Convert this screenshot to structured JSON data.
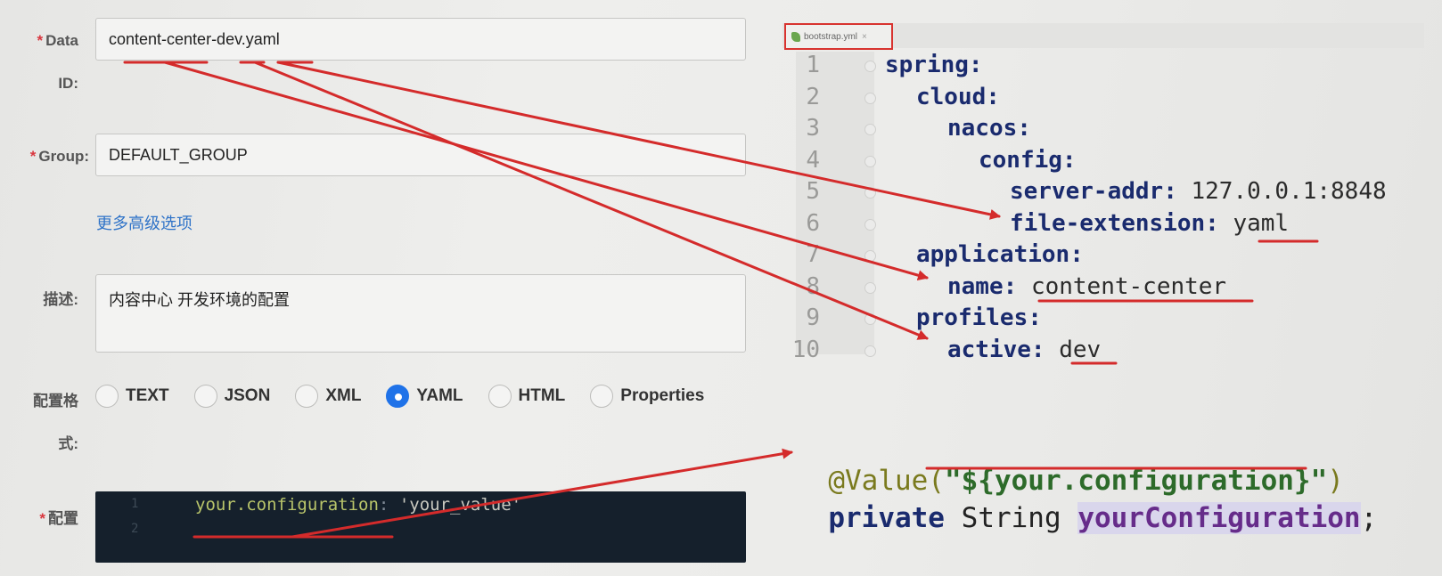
{
  "form": {
    "data_id": {
      "label_line1": "Data",
      "label_line2": "ID:",
      "value": "content-center-dev.yaml"
    },
    "group": {
      "label": "Group:",
      "value": "DEFAULT_GROUP"
    },
    "advanced_link": "更多高级选项",
    "description": {
      "label": "描述:",
      "value": "内容中心 开发环境的配置"
    },
    "format": {
      "label_line1": "配置格",
      "label_line2": "式:",
      "options": [
        "TEXT",
        "JSON",
        "XML",
        "YAML",
        "HTML",
        "Properties"
      ],
      "selected": "YAML"
    },
    "config": {
      "label": "配置",
      "line_numbers": [
        "1",
        "2"
      ],
      "key": "your.configuration",
      "colon": ":",
      "value": "'your_value'"
    },
    "required_mark": "*"
  },
  "editor": {
    "tab_label": "bootstrap.yml",
    "tab_close": "×",
    "lines": [
      {
        "num": "1",
        "key": "spring",
        "sep": ":",
        "value": ""
      },
      {
        "num": "2",
        "key": "cloud",
        "sep": ":",
        "value": ""
      },
      {
        "num": "3",
        "key": "nacos",
        "sep": ":",
        "value": ""
      },
      {
        "num": "4",
        "key": "config",
        "sep": ":",
        "value": ""
      },
      {
        "num": "5",
        "key": "server-addr",
        "sep": ": ",
        "value": "127.0.0.1:8848"
      },
      {
        "num": "6",
        "key": "file-extension",
        "sep": ": ",
        "value": "yaml"
      },
      {
        "num": "7",
        "key": "application",
        "sep": ":",
        "value": ""
      },
      {
        "num": "8",
        "key": "name",
        "sep": ": ",
        "value": "content-center"
      },
      {
        "num": "9",
        "key": "profiles",
        "sep": ":",
        "value": ""
      },
      {
        "num": "10",
        "key": "active",
        "sep": ": ",
        "value": "dev"
      }
    ]
  },
  "java": {
    "annotation": "@Value(",
    "annotation_arg": "\"${your.configuration}\"",
    "annotation_close": ")",
    "keyword": "private",
    "type": "String",
    "field": "yourConfiguration",
    "semicolon": ";"
  },
  "colors": {
    "arrow": "#d42b2b",
    "underline": "#d42b2b",
    "radio_selected": "#1f72e8",
    "editor_bg": "#15202c",
    "yaml_key": "#1a2b6e"
  }
}
